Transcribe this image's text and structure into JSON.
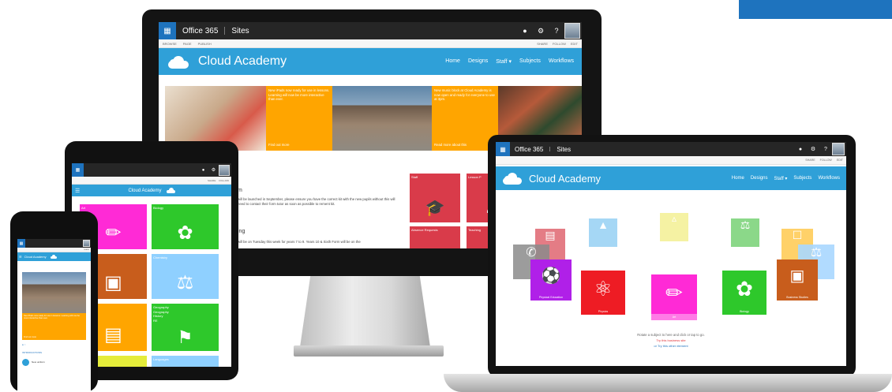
{
  "colors": {
    "accent": "#2fa0d8",
    "o365_bar": "#262626",
    "o365_waffle": "#1e73be",
    "orange": "#ffa500",
    "red": "#d93b4a",
    "magenta": "#ff2ad6",
    "green": "#2ec82b",
    "lightblue": "#8fd0ff",
    "brown": "#c85d1c",
    "yellow": "#e4ec3a"
  },
  "site": {
    "title": "Cloud Academy",
    "nav": [
      "Home",
      "Designs",
      "Staff ▾",
      "Subjects",
      "Workflows"
    ]
  },
  "o365": {
    "brand": "Office 365",
    "app": "Sites",
    "icons": [
      "bell-icon",
      "gear-icon",
      "help-icon"
    ]
  },
  "ribbon": {
    "left": [
      "BROWSE",
      "PAGE",
      "PUBLISH"
    ],
    "right": [
      "SHARE",
      "FOLLOW",
      "EDIT"
    ]
  },
  "monitor": {
    "promo1": "New iPads now ready for use in lessons. Learning will now be more interactive than ever.",
    "promo1_link": "Find out more",
    "promo2": "New music block at Cloud Academy is now open and ready for everyone to use at 3pm.",
    "promo2_link": "Read more about this",
    "news_heading": "m",
    "news1": "will be launched in September, please ensure you have the correct kit with the new pupils without this will need to contact their form tutor as soon as possible to rement kit.",
    "news2_heading": "ing",
    "news2": "will be on Tuesday this week for years 7 to 9. Years 10 & Sixth Form will be on the",
    "tiles": [
      "Staff",
      "Lesson P",
      "Absence Requests",
      "Teaching"
    ]
  },
  "laptop": {
    "tiles": [
      "Physical Education",
      "Physics",
      "Art",
      "Biology",
      "Business Studies"
    ],
    "prompt": "Rotate a subject to here and click or tap to go.",
    "link1": "Try this business site",
    "link2": "or Try this other element"
  },
  "tablet": {
    "tiles": [
      "Art",
      "Biology",
      "Studies",
      "Chemistry",
      "Geography",
      "English",
      "Languages"
    ],
    "geo_sub": [
      "Geography",
      "History",
      "RE"
    ]
  },
  "phone": {
    "promo": "New iPads now ready for use in lessons. Learning will now be more interactive than ever.",
    "link": "Find out more",
    "section": "INTRODUCTIONS",
    "item": "New uniform"
  }
}
